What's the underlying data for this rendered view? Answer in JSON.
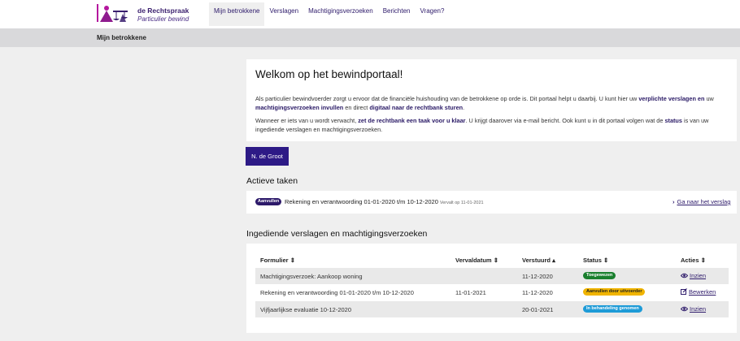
{
  "brand": {
    "title": "de Rechtspraak",
    "subtitle": "Particulier bewind"
  },
  "nav": [
    {
      "label": "Mijn betrokkene",
      "active": true
    },
    {
      "label": "Verslagen",
      "active": false
    },
    {
      "label": "Machtigingsverzoeken",
      "active": false
    },
    {
      "label": "Berichten",
      "active": false
    },
    {
      "label": "Vragen?",
      "active": false
    }
  ],
  "breadcrumb": "Mijn betrokkene",
  "welcome": {
    "title": "Welkom op het bewindportaal!",
    "p1_a": "Als particulier bewindvoerder zorgt u ervoor dat de financiële huishouding van de betrokkene op orde is. Dit portaal helpt u daarbij. U kunt hier uw ",
    "p1_b": "verplichte verslagen en",
    "p1_c": " uw ",
    "p1_d": "machtigingsverzoeken invullen",
    "p1_e": " en direct ",
    "p1_f": "digitaal naar de rechtbank sturen",
    "p1_g": ".",
    "p2_a": "Wanneer er iets van u wordt verwacht, ",
    "p2_b": "zet de rechtbank een taak voor u klaar",
    "p2_c": ". U krijgt daarover via e-mail bericht. Ook kunt u in dit portaal volgen wat de ",
    "p2_d": "status",
    "p2_e": " is van uw ingediende verslagen en machtigingsverzoeken."
  },
  "person_button": "N. de Groot",
  "active_tasks": {
    "title": "Actieve taken",
    "task": {
      "badge": "Aanvullen",
      "text": "Rekening en verantwoording 01-01-2020 t/m 10-12-2020",
      "due": "Vervalt op 11-01-2021",
      "link": "Ga naar het verslag"
    }
  },
  "submitted": {
    "title": "Ingediende verslagen en machtigingsverzoeken",
    "headers": {
      "formulier": "Formulier",
      "vervaldatum": "Vervaldatum",
      "verstuurd": "Verstuurd",
      "status": "Status",
      "acties": "Acties"
    },
    "rows": [
      {
        "formulier": "Machtigingsverzoek: Aankoop woning",
        "vervaldatum": "",
        "verstuurd": "11-12-2020",
        "status": "Toegewezen",
        "status_bg": "#1a7f2e",
        "status_fg": "#ffffff",
        "action": "Inzien",
        "action_icon": "eye-icon"
      },
      {
        "formulier": "Rekening en verantwoording 01-01-2020 t/m 10-12-2020",
        "vervaldatum": "11-01-2021",
        "verstuurd": "11-12-2020",
        "status": "Aanvullen door uitvoerder",
        "status_bg": "#f0b400",
        "status_fg": "#222222",
        "action": "Bewerken",
        "action_icon": "edit-icon"
      },
      {
        "formulier": "Vijfjaarlijkse evaluatie 10-12-2020",
        "vervaldatum": "",
        "verstuurd": "20-01-2021",
        "status": "In behandeling genomen",
        "status_bg": "#1e9bd7",
        "status_fg": "#ffffff",
        "action": "Inzien",
        "action_icon": "eye-icon"
      }
    ]
  },
  "colors": {
    "brand": "#2d1a6a",
    "button": "#2d1a86"
  }
}
